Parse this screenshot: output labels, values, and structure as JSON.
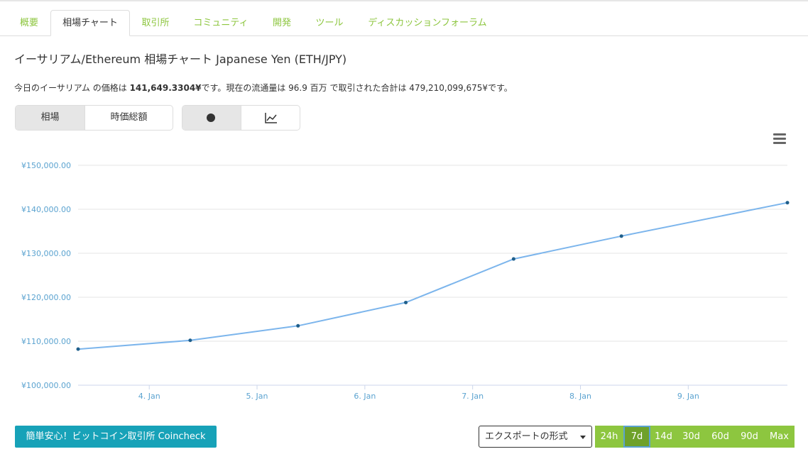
{
  "tabs": [
    {
      "label": "概要"
    },
    {
      "label": "相場チャート"
    },
    {
      "label": "取引所"
    },
    {
      "label": "コミュニティ"
    },
    {
      "label": "開発"
    },
    {
      "label": "ツール"
    },
    {
      "label": "ディスカッションフォーラム"
    }
  ],
  "active_tab": "相場チャート",
  "heading": "イーサリアム/Ethereum 相場チャート Japanese Yen (ETH/JPY)",
  "description": {
    "part1": "今日のイーサリアム の価格は ",
    "price": "141,649.3304¥",
    "part2": "です。現在の流通量は 96.9 百万 で取引された合計は 479,210,099,675¥です。"
  },
  "toggle_group1": {
    "items": [
      "相場",
      "時価総額"
    ],
    "selected": "相場"
  },
  "toggle_group2": {
    "icons": [
      "circle-icon",
      "line-chart-icon"
    ],
    "selected": "circle-icon"
  },
  "menu_icon": "hamburger-menu-icon",
  "chart_data": {
    "type": "line",
    "x_ticks": [
      "4. Jan",
      "5. Jan",
      "6. Jan",
      "7. Jan",
      "8. Jan",
      "9. Jan"
    ],
    "y_ticks": [
      "¥100,000.00",
      "¥110,000.00",
      "¥120,000.00",
      "¥130,000.00",
      "¥140,000.00",
      "¥150,000.00"
    ],
    "ylim": [
      100000,
      150000
    ],
    "x_range": [
      3.34,
      9.92
    ],
    "series": [
      {
        "points": [
          {
            "x": 3.34,
            "y": 108200
          },
          {
            "x": 4.38,
            "y": 110200
          },
          {
            "x": 5.38,
            "y": 113500
          },
          {
            "x": 6.38,
            "y": 118800
          },
          {
            "x": 7.38,
            "y": 128700
          },
          {
            "x": 8.38,
            "y": 133900
          },
          {
            "x": 9.92,
            "y": 141500
          }
        ]
      }
    ],
    "colors": {
      "line": "#7cb5ec",
      "marker": "#1f5f8b",
      "axis_text": "#5ba3d0",
      "grid": "#e6e6e6"
    },
    "grid": true,
    "legend": "none"
  },
  "promo_button": "簡単安心！ビットコイン取引所 Coincheck",
  "export_button": "エクスポートの形式",
  "range_buttons": [
    "24h",
    "7d",
    "14d",
    "30d",
    "60d",
    "90d",
    "Max"
  ],
  "range_selected": "7d",
  "colors": {
    "accent": "#8dc63f",
    "promo": "#17a2b8"
  }
}
